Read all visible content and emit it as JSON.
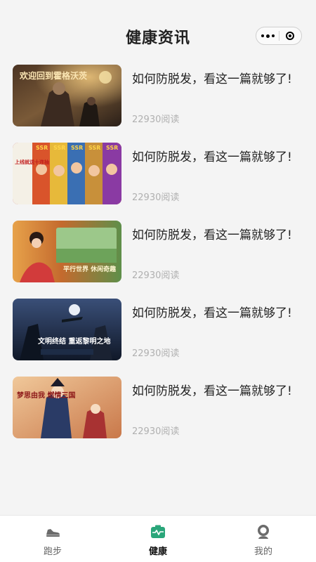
{
  "header": {
    "title": "健康资讯"
  },
  "articles": [
    {
      "title": "如何防脱发，看这一篇就够了!",
      "reads": "22930阅读",
      "thumb_text": "欢迎回到霍格沃茨"
    },
    {
      "title": "如何防脱发，看这一篇就够了!",
      "reads": "22930阅读",
      "thumb_text": "上线就送十连抽"
    },
    {
      "title": "如何防脱发，看这一篇就够了!",
      "reads": "22930阅读",
      "thumb_text": "平行世界 休闲奇趣"
    },
    {
      "title": "如何防脱发，看这一篇就够了!",
      "reads": "22930阅读",
      "thumb_text": "文明终结 重返黎明之地"
    },
    {
      "title": "如何防脱发，看这一篇就够了!",
      "reads": "22930阅读",
      "thumb_text": "梦思由我 燃情三国"
    }
  ],
  "tabbar": {
    "items": [
      {
        "label": "跑步",
        "icon": "sneaker-icon"
      },
      {
        "label": "健康",
        "icon": "health-heartbeat-icon"
      },
      {
        "label": "我的",
        "icon": "user-icon"
      }
    ],
    "active": "健康",
    "accent_color": "#2aa67a"
  }
}
